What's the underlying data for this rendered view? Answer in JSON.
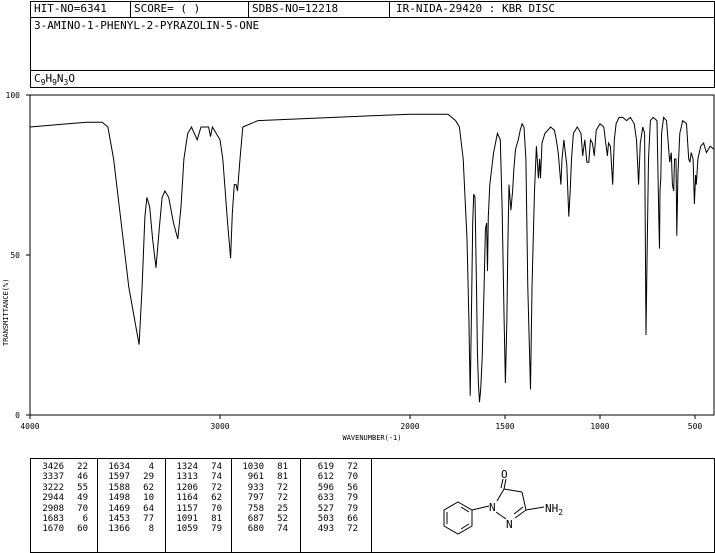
{
  "header": {
    "hit_no": "HIT-NO=6341",
    "score": "SCORE=  (   )",
    "sdbs_no": "SDBS-NO=12218",
    "method": "IR-NIDA-29420 : KBR DISC"
  },
  "compound": {
    "name": "3-AMINO-1-PHENYL-2-PYRAZOLIN-5-ONE",
    "formula_c": "C",
    "formula_c_sub": "9",
    "formula_h": "H",
    "formula_h_sub": "9",
    "formula_n": "N",
    "formula_n_sub": "3",
    "formula_o": "O"
  },
  "chart_data": {
    "type": "line",
    "xlabel": "WAVENUMBER(-1)",
    "ylabel": "TRANSMITTANCE(%)",
    "xlim": [
      4000,
      400
    ],
    "ylim": [
      0,
      100
    ],
    "x_ticks": [
      4000,
      3000,
      2000,
      1500,
      1000,
      500
    ],
    "y_ticks": [
      0,
      50,
      100
    ],
    "series": [
      {
        "points": [
          [
            4000,
            90
          ],
          [
            3800,
            91
          ],
          [
            3700,
            91.5
          ],
          [
            3620,
            91.5
          ],
          [
            3590,
            90
          ],
          [
            3560,
            80
          ],
          [
            3520,
            60
          ],
          [
            3480,
            40
          ],
          [
            3450,
            30
          ],
          [
            3426,
            22
          ],
          [
            3410,
            40
          ],
          [
            3395,
            62
          ],
          [
            3385,
            68
          ],
          [
            3370,
            65
          ],
          [
            3355,
            55
          ],
          [
            3337,
            46
          ],
          [
            3320,
            58
          ],
          [
            3305,
            68
          ],
          [
            3290,
            70
          ],
          [
            3270,
            68
          ],
          [
            3245,
            60
          ],
          [
            3222,
            55
          ],
          [
            3205,
            65
          ],
          [
            3190,
            80
          ],
          [
            3170,
            88
          ],
          [
            3150,
            90
          ],
          [
            3120,
            86
          ],
          [
            3100,
            90
          ],
          [
            3060,
            90
          ],
          [
            3050,
            87
          ],
          [
            3040,
            90
          ],
          [
            3020,
            88
          ],
          [
            3000,
            86
          ],
          [
            2985,
            80
          ],
          [
            2960,
            60
          ],
          [
            2944,
            49
          ],
          [
            2935,
            63
          ],
          [
            2925,
            72
          ],
          [
            2915,
            72
          ],
          [
            2908,
            70
          ],
          [
            2895,
            80
          ],
          [
            2880,
            90
          ],
          [
            2800,
            92
          ],
          [
            2600,
            92.5
          ],
          [
            2400,
            93
          ],
          [
            2200,
            93.5
          ],
          [
            2000,
            94
          ],
          [
            1900,
            94
          ],
          [
            1800,
            94
          ],
          [
            1760,
            92
          ],
          [
            1740,
            90
          ],
          [
            1720,
            80
          ],
          [
            1700,
            55
          ],
          [
            1690,
            30
          ],
          [
            1683,
            6
          ],
          [
            1676,
            35
          ],
          [
            1670,
            60
          ],
          [
            1665,
            69
          ],
          [
            1658,
            68
          ],
          [
            1650,
            40
          ],
          [
            1645,
            20
          ],
          [
            1640,
            10
          ],
          [
            1634,
            4
          ],
          [
            1628,
            8
          ],
          [
            1620,
            18
          ],
          [
            1610,
            40
          ],
          [
            1603,
            58
          ],
          [
            1597,
            60
          ],
          [
            1592,
            45
          ],
          [
            1588,
            62
          ],
          [
            1580,
            72
          ],
          [
            1560,
            82
          ],
          [
            1540,
            88
          ],
          [
            1525,
            86
          ],
          [
            1515,
            65
          ],
          [
            1505,
            30
          ],
          [
            1498,
            10
          ],
          [
            1490,
            30
          ],
          [
            1485,
            52
          ],
          [
            1479,
            72
          ],
          [
            1469,
            64
          ],
          [
            1460,
            70
          ],
          [
            1453,
            77
          ],
          [
            1445,
            83
          ],
          [
            1430,
            86
          ],
          [
            1420,
            89
          ],
          [
            1410,
            91
          ],
          [
            1400,
            90
          ],
          [
            1390,
            80
          ],
          [
            1380,
            40
          ],
          [
            1366,
            8
          ],
          [
            1358,
            40
          ],
          [
            1345,
            70
          ],
          [
            1335,
            84
          ],
          [
            1324,
            74
          ],
          [
            1318,
            80
          ],
          [
            1313,
            74
          ],
          [
            1305,
            85
          ],
          [
            1290,
            88
          ],
          [
            1260,
            90
          ],
          [
            1240,
            89
          ],
          [
            1230,
            86
          ],
          [
            1220,
            82
          ],
          [
            1206,
            72
          ],
          [
            1200,
            80
          ],
          [
            1190,
            86
          ],
          [
            1175,
            78
          ],
          [
            1164,
            62
          ],
          [
            1157,
            70
          ],
          [
            1150,
            80
          ],
          [
            1140,
            88
          ],
          [
            1120,
            90
          ],
          [
            1100,
            88
          ],
          [
            1091,
            81
          ],
          [
            1080,
            86
          ],
          [
            1069,
            79
          ],
          [
            1059,
            79
          ],
          [
            1050,
            86
          ],
          [
            1040,
            85
          ],
          [
            1030,
            81
          ],
          [
            1020,
            89
          ],
          [
            1000,
            91
          ],
          [
            980,
            90
          ],
          [
            970,
            85
          ],
          [
            961,
            81
          ],
          [
            955,
            85
          ],
          [
            945,
            84
          ],
          [
            933,
            72
          ],
          [
            925,
            86
          ],
          [
            915,
            91
          ],
          [
            900,
            93
          ],
          [
            880,
            93
          ],
          [
            860,
            92
          ],
          [
            840,
            93
          ],
          [
            820,
            91
          ],
          [
            808,
            86
          ],
          [
            797,
            72
          ],
          [
            788,
            85
          ],
          [
            775,
            90
          ],
          [
            765,
            88
          ],
          [
            758,
            25
          ],
          [
            752,
            50
          ],
          [
            745,
            80
          ],
          [
            735,
            92
          ],
          [
            720,
            93
          ],
          [
            700,
            92
          ],
          [
            690,
            60
          ],
          [
            687,
            52
          ],
          [
            684,
            70
          ],
          [
            680,
            74
          ],
          [
            676,
            88
          ],
          [
            665,
            93
          ],
          [
            650,
            92
          ],
          [
            633,
            79
          ],
          [
            625,
            82
          ],
          [
            619,
            72
          ],
          [
            612,
            70
          ],
          [
            608,
            80
          ],
          [
            600,
            80
          ],
          [
            596,
            56
          ],
          [
            590,
            75
          ],
          [
            580,
            88
          ],
          [
            565,
            92
          ],
          [
            545,
            91
          ],
          [
            533,
            80
          ],
          [
            527,
            79
          ],
          [
            520,
            82
          ],
          [
            510,
            80
          ],
          [
            503,
            66
          ],
          [
            497,
            75
          ],
          [
            493,
            72
          ],
          [
            485,
            80
          ],
          [
            470,
            84
          ],
          [
            455,
            85
          ],
          [
            440,
            82
          ],
          [
            420,
            84
          ],
          [
            400,
            83
          ]
        ]
      }
    ],
    "peaks": [
      [
        3426,
        22
      ],
      [
        3337,
        46
      ],
      [
        3222,
        55
      ],
      [
        2944,
        49
      ],
      [
        2908,
        70
      ],
      [
        1683,
        6
      ],
      [
        1670,
        60
      ],
      [
        1634,
        4
      ],
      [
        1597,
        29
      ],
      [
        1588,
        62
      ],
      [
        1498,
        10
      ],
      [
        1469,
        64
      ],
      [
        1453,
        77
      ],
      [
        1366,
        8
      ],
      [
        1324,
        74
      ],
      [
        1313,
        74
      ],
      [
        1206,
        72
      ],
      [
        1164,
        62
      ],
      [
        1157,
        70
      ],
      [
        1091,
        81
      ],
      [
        1059,
        79
      ],
      [
        1030,
        81
      ],
      [
        961,
        81
      ],
      [
        933,
        72
      ],
      [
        797,
        72
      ],
      [
        758,
        25
      ],
      [
        687,
        52
      ],
      [
        680,
        74
      ],
      [
        619,
        72
      ],
      [
        612,
        70
      ],
      [
        596,
        56
      ],
      [
        633,
        79
      ],
      [
        527,
        79
      ],
      [
        503,
        66
      ],
      [
        493,
        72
      ]
    ]
  },
  "peak_table": [
    [
      [
        "3426",
        "22"
      ],
      [
        "3337",
        "46"
      ],
      [
        "3222",
        "55"
      ],
      [
        "2944",
        "49"
      ],
      [
        "2908",
        "70"
      ],
      [
        "1683",
        "6"
      ],
      [
        "1670",
        "60"
      ]
    ],
    [
      [
        "1634",
        "4"
      ],
      [
        "1597",
        "29"
      ],
      [
        "1588",
        "62"
      ],
      [
        "1498",
        "10"
      ],
      [
        "1469",
        "64"
      ],
      [
        "1453",
        "77"
      ],
      [
        "1366",
        "8"
      ]
    ],
    [
      [
        "1324",
        "74"
      ],
      [
        "1313",
        "74"
      ],
      [
        "1206",
        "72"
      ],
      [
        "1164",
        "62"
      ],
      [
        "1157",
        "70"
      ],
      [
        "1091",
        "81"
      ],
      [
        "1059",
        "79"
      ]
    ],
    [
      [
        "1030",
        "81"
      ],
      [
        "961",
        "81"
      ],
      [
        "933",
        "72"
      ],
      [
        "797",
        "72"
      ],
      [
        "758",
        "25"
      ],
      [
        "687",
        "52"
      ],
      [
        "680",
        "74"
      ]
    ],
    [
      [
        "619",
        "72"
      ],
      [
        "612",
        "70"
      ],
      [
        "596",
        "56"
      ],
      [
        "633",
        "79"
      ],
      [
        "527",
        "79"
      ],
      [
        "503",
        "66"
      ],
      [
        "493",
        "72"
      ]
    ]
  ],
  "structure": {
    "o_label": "O",
    "n1_label": "N",
    "n2_label": "N",
    "nh2_label": "NH",
    "nh2_sub": "2"
  }
}
